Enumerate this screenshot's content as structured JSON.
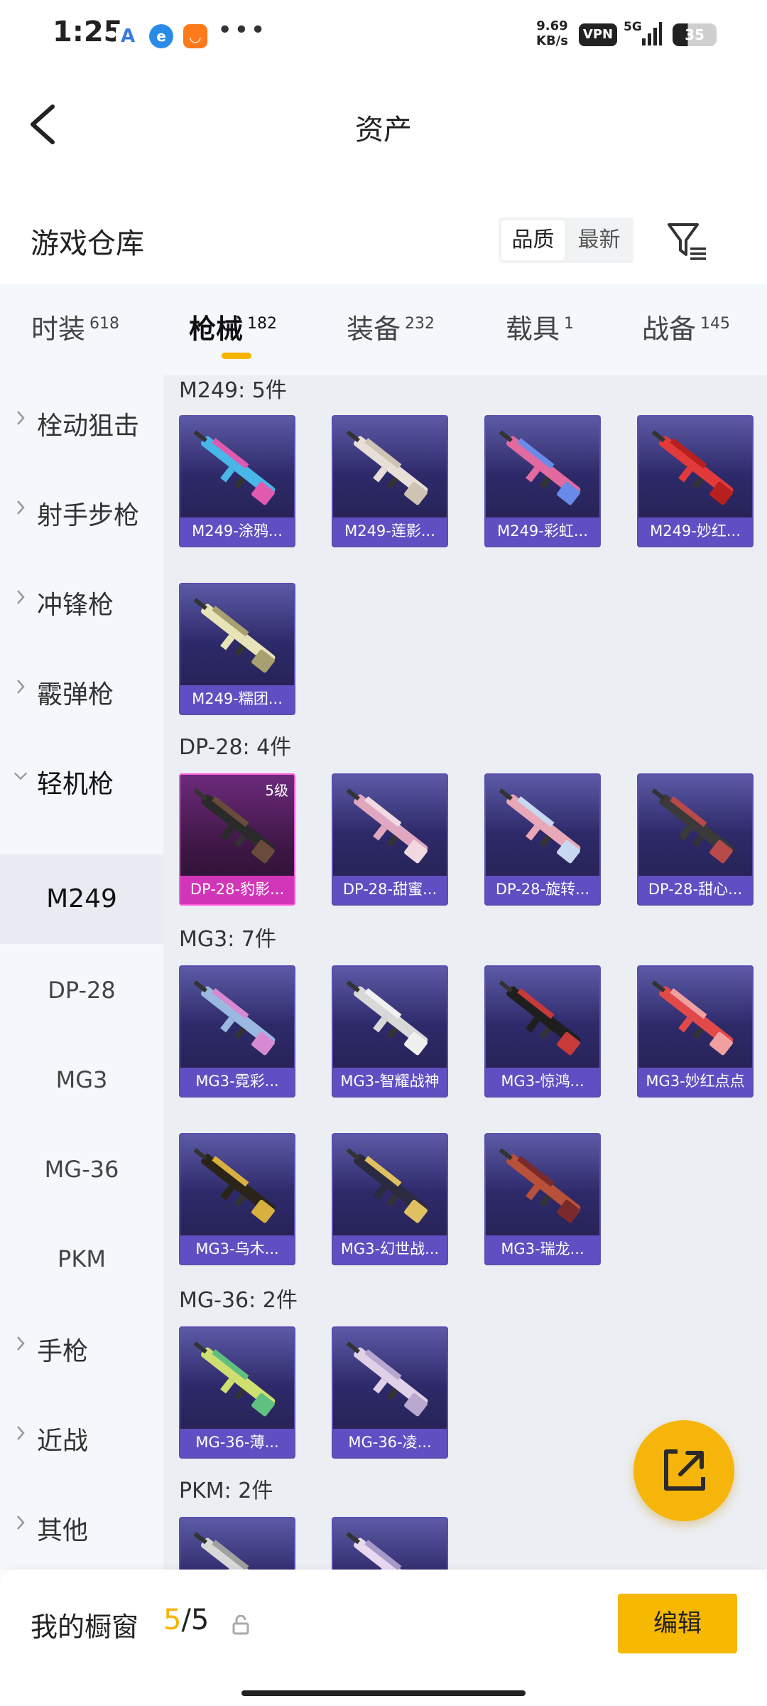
{
  "status_bar": {
    "time": "1:25",
    "speed_value": "9.69",
    "speed_unit": "KB/s",
    "vpn": "VPN",
    "network": "5G",
    "battery": "35",
    "app_icons": [
      "a-icon",
      "browser-icon",
      "shop-icon"
    ],
    "more": "•••"
  },
  "header": {
    "title": "资产"
  },
  "warehouse": {
    "title": "游戏仓库",
    "sort_options": [
      "品质",
      "最新"
    ]
  },
  "tabs": [
    {
      "label": "时装",
      "count": "618"
    },
    {
      "label": "枪械",
      "count": "182"
    },
    {
      "label": "装备",
      "count": "232"
    },
    {
      "label": "载具",
      "count": "1"
    },
    {
      "label": "战备",
      "count": "145"
    }
  ],
  "sidebar": {
    "categories": [
      "栓动狙击",
      "射手步枪",
      "冲锋枪",
      "霰弹枪",
      "轻机枪"
    ],
    "sub_items": [
      "M249",
      "DP-28",
      "MG3",
      "MG-36",
      "PKM"
    ],
    "categories_after": [
      "手枪",
      "近战",
      "其他"
    ]
  },
  "groups": [
    {
      "label": "M249: 5件",
      "items": [
        "M249-涂鸦...",
        "M249-莲影...",
        "M249-彩虹...",
        "M249-妙红...",
        "M249-糯团..."
      ]
    },
    {
      "label": "DP-28: 4件",
      "items": [
        "DP-28-豹影...",
        "DP-28-甜蜜...",
        "DP-28-旋转...",
        "DP-28-甜心..."
      ],
      "first_level": "5级"
    },
    {
      "label": "MG3: 7件",
      "items": [
        "MG3-霓彩...",
        "MG3-智耀战神",
        "MG3-惊鸿...",
        "MG3-妙红点点",
        "MG3-乌木...",
        "MG3-幻世战...",
        "MG3-瑞龙..."
      ]
    },
    {
      "label": "MG-36: 2件",
      "items": [
        "MG-36-薄...",
        "MG-36-凌..."
      ]
    },
    {
      "label": "PKM: 2件",
      "items": [
        "",
        ""
      ]
    }
  ],
  "bottom": {
    "window_label": "我的橱窗",
    "window_current": "5",
    "window_total": "/5",
    "edit": "编辑"
  },
  "colors": {
    "accent": "#f5b400",
    "card_caption": "#5f4fc2",
    "rare_card_caption": "#d136b8"
  }
}
